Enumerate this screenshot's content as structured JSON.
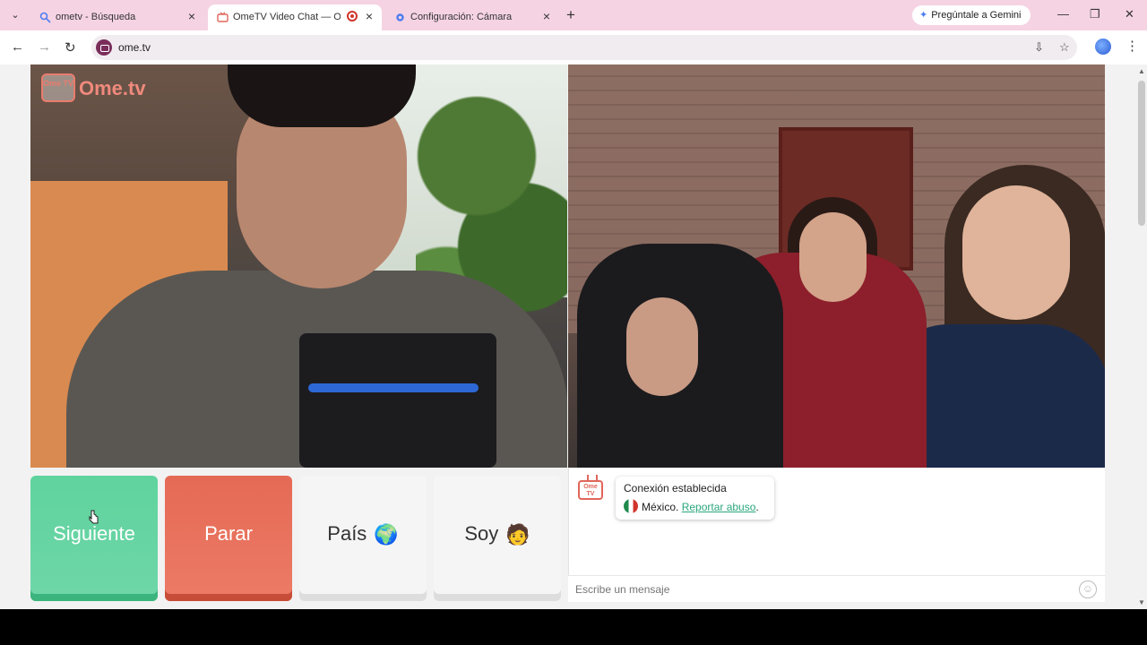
{
  "browser": {
    "tabs": [
      {
        "label": "ometv - Búsqueda",
        "icon": "search-icon"
      },
      {
        "label": "OmeTV Video Chat — Ome",
        "icon": "ometv-icon",
        "active": true,
        "recording": true
      },
      {
        "label": "Configuración: Cámara",
        "icon": "gear-icon"
      }
    ],
    "new_tab": "+",
    "gemini_label": "Pregúntale a Gemini",
    "url": "ome.tv"
  },
  "page": {
    "logo_text": "Ome.tv",
    "logo_badge": "Ome TV",
    "buttons": {
      "next": "Siguiente",
      "stop": "Parar",
      "country": "País",
      "gender": "Soy"
    },
    "chat": {
      "status": "Conexión establecida",
      "country": "México.",
      "report_link": "Reportar abuso",
      "report_suffix": ".",
      "message_placeholder": "Escribe un mensaje"
    }
  },
  "colors": {
    "next": "#5fd39e",
    "stop": "#e56a55",
    "tabbar": "#f5d3e3",
    "link": "#2aa77c"
  }
}
